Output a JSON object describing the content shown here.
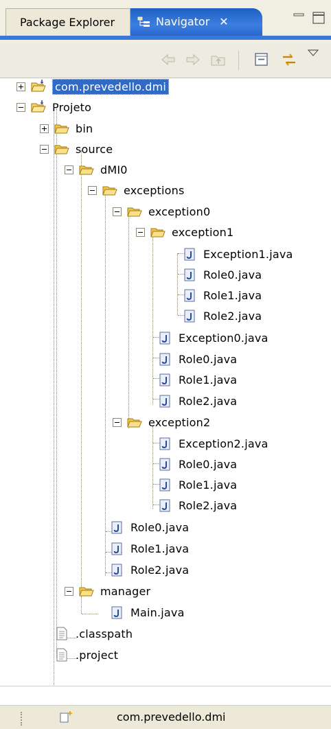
{
  "tabs": {
    "package_explorer": "Package Explorer",
    "navigator": "Navigator",
    "close_glyph": "✕"
  },
  "toolbar": {
    "buttons": [
      "back-icon",
      "forward-icon",
      "up-icon",
      "collapse-all-icon",
      "link-with-editor-icon",
      "view-menu-icon"
    ]
  },
  "tree": {
    "nodes": [
      {
        "label": "com.prevedello.dmi",
        "icon": "project-folder",
        "toggle": "plus",
        "selected": true
      },
      {
        "label": "Projeto",
        "icon": "project-folder",
        "toggle": "minus"
      },
      {
        "label": "bin",
        "icon": "folder",
        "toggle": "plus"
      },
      {
        "label": "source",
        "icon": "folder",
        "toggle": "minus"
      },
      {
        "label": "dMI0",
        "icon": "folder",
        "toggle": "minus"
      },
      {
        "label": "exceptions",
        "icon": "folder",
        "toggle": "minus"
      },
      {
        "label": "exception0",
        "icon": "folder",
        "toggle": "minus"
      },
      {
        "label": "exception1",
        "icon": "folder",
        "toggle": "minus"
      },
      {
        "label": "Exception1.java",
        "icon": "java-file"
      },
      {
        "label": "Role0.java",
        "icon": "java-file"
      },
      {
        "label": "Role1.java",
        "icon": "java-file"
      },
      {
        "label": "Role2.java",
        "icon": "java-file"
      },
      {
        "label": "Exception0.java",
        "icon": "java-file"
      },
      {
        "label": "Role0.java",
        "icon": "java-file"
      },
      {
        "label": "Role1.java",
        "icon": "java-file"
      },
      {
        "label": "Role2.java",
        "icon": "java-file"
      },
      {
        "label": "exception2",
        "icon": "folder",
        "toggle": "minus"
      },
      {
        "label": "Exception2.java",
        "icon": "java-file"
      },
      {
        "label": "Role0.java",
        "icon": "java-file"
      },
      {
        "label": "Role1.java",
        "icon": "java-file"
      },
      {
        "label": "Role2.java",
        "icon": "java-file"
      },
      {
        "label": "Role0.java",
        "icon": "java-file"
      },
      {
        "label": "Role1.java",
        "icon": "java-file"
      },
      {
        "label": "Role2.java",
        "icon": "java-file"
      },
      {
        "label": "manager",
        "icon": "folder",
        "toggle": "minus"
      },
      {
        "label": "Main.java",
        "icon": "java-file"
      },
      {
        "label": ".classpath",
        "icon": "text-file"
      },
      {
        "label": ".project",
        "icon": "text-file"
      }
    ]
  },
  "statusbar": {
    "text": "com.prevedello.dmi",
    "icon": "new-element-icon"
  },
  "colors": {
    "selection": "#316ac5",
    "active_tab": "#3b7fe0",
    "folder": "#f3c64b"
  }
}
